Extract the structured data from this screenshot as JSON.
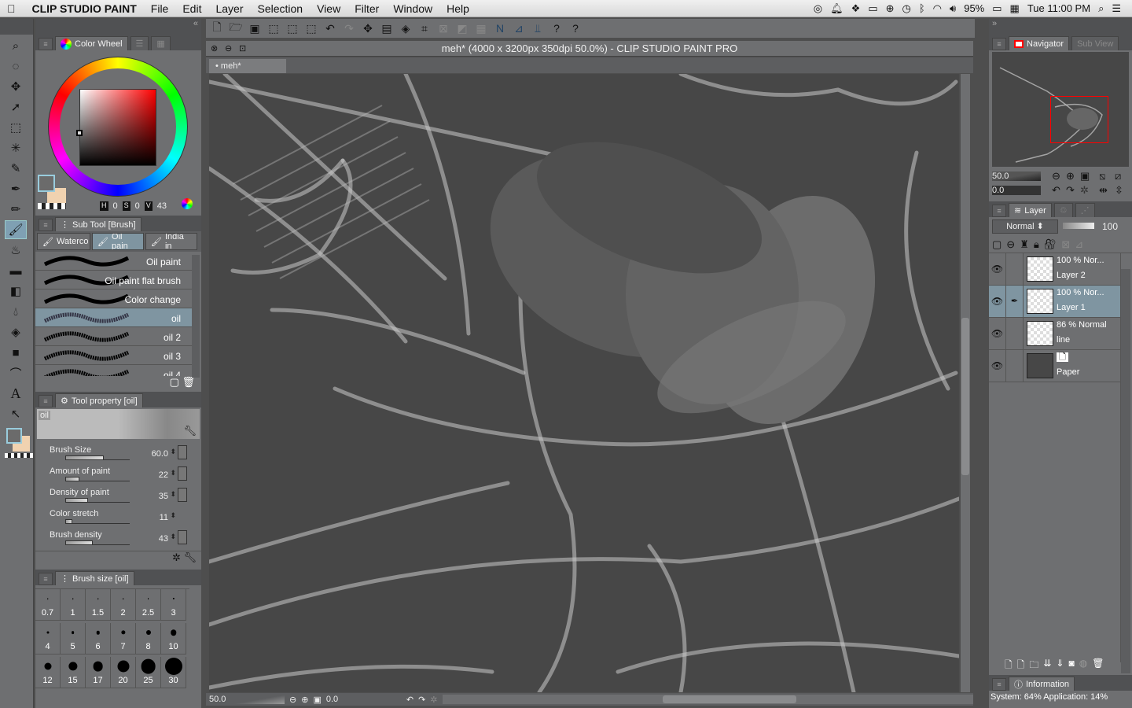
{
  "menubar": {
    "app": "CLIP STUDIO PAINT",
    "items": [
      "File",
      "Edit",
      "Layer",
      "Selection",
      "View",
      "Filter",
      "Window",
      "Help"
    ],
    "battery": "95%",
    "clock": "Tue 11:00 PM"
  },
  "color_wheel": {
    "tab": "Color Wheel",
    "h_label": "H",
    "h": "0",
    "s_label": "S",
    "s": "0",
    "v_label": "V",
    "v": "43",
    "main_color": "#6b6b6b",
    "sub_color": "#f0d2b0"
  },
  "subtool": {
    "tab": "Sub Tool [Brush]",
    "groups": [
      "Waterco",
      "Oil pain",
      "India in"
    ],
    "brushes": [
      "Oil paint",
      "Oil paint flat brush",
      "Color change",
      "oil",
      "oil 2",
      "oil 3",
      "oil 4"
    ],
    "selected": "oil"
  },
  "tool_property": {
    "tab": "Tool property [oil]",
    "preview_name": "oil",
    "props": [
      {
        "label": "Brush Size",
        "value": "60.0",
        "fraction": 0.6
      },
      {
        "label": "Amount of paint",
        "value": "22",
        "fraction": 0.22
      },
      {
        "label": "Density of paint",
        "value": "35",
        "fraction": 0.35
      },
      {
        "label": "Color stretch",
        "value": "11",
        "fraction": 0.11
      },
      {
        "label": "Brush density",
        "value": "43",
        "fraction": 0.43
      }
    ]
  },
  "brush_size": {
    "tab": "Brush size [oil]",
    "sizes": [
      "0.7",
      "1",
      "1.5",
      "2",
      "2.5",
      "3",
      "4",
      "5",
      "6",
      "7",
      "8",
      "10",
      "12",
      "15",
      "17",
      "20",
      "25",
      "30"
    ]
  },
  "canvas": {
    "title": "meh* (4000 x 3200px 350dpi 50.0%)  - CLIP STUDIO PAINT PRO",
    "tab": "meh*",
    "zoom": "50.0",
    "rotation": "0.0"
  },
  "navigator": {
    "tab": "Navigator",
    "tab2": "Sub View",
    "zoom": "50.0",
    "rotation": "0.0"
  },
  "layer": {
    "tab": "Layer",
    "blend": "Normal",
    "opacity": "100",
    "layers": [
      {
        "info": "100 % Nor...",
        "name": "Layer 2"
      },
      {
        "info": "100 % Nor...",
        "name": "Layer 1",
        "selected": true
      },
      {
        "info": "86 % Normal",
        "name": "line"
      },
      {
        "info": "",
        "name": "Paper"
      }
    ]
  },
  "information": {
    "tab": "Information",
    "status": "System: 64% Application: 14%"
  }
}
